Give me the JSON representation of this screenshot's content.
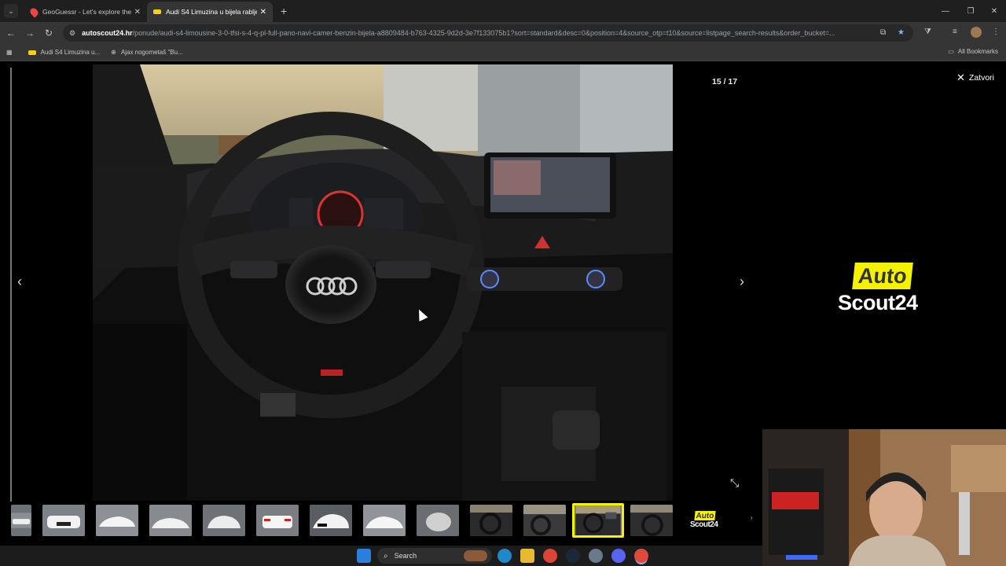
{
  "browser": {
    "tabs": [
      {
        "title": "GeoGuessr - Let's explore the w",
        "icon": "map-pin-icon"
      },
      {
        "title": "Audi S4 Limuzina u bijela rablje",
        "icon": "autoscout-favicon",
        "active": true
      }
    ],
    "new_tab": "+",
    "url_domain": "autoscout24.hr",
    "url_path": "/ponude/audi-s4-limousine-3-0-tfsi-s-4-q-pl-full-pano-navi-camer-benzin-bijela-a8809484-b763-4325-9d2d-3e7f133075b1?sort=standard&desc=0&position=4&source_otp=t10&source=listpage_search-results&order_bucket=...",
    "bookmarks": [
      {
        "label": "Audi S4 Limuzina u...",
        "icon": "autoscout-favicon"
      },
      {
        "label": "Ajax nogometaš \"Bu...",
        "icon": "globe-icon"
      }
    ],
    "all_bookmarks": "All Bookmarks"
  },
  "gallery": {
    "counter": "15 / 17",
    "close_label": "Zatvori",
    "logo_auto": "Auto",
    "logo_scout": "Scout24",
    "selected_thumb_index": 11,
    "thumb_count": 13
  },
  "taskbar": {
    "search_label": "Search"
  },
  "colors": {
    "accent_yellow": "#f5f200",
    "chrome_dark": "#1f1f1f",
    "chrome_mid": "#353535"
  }
}
